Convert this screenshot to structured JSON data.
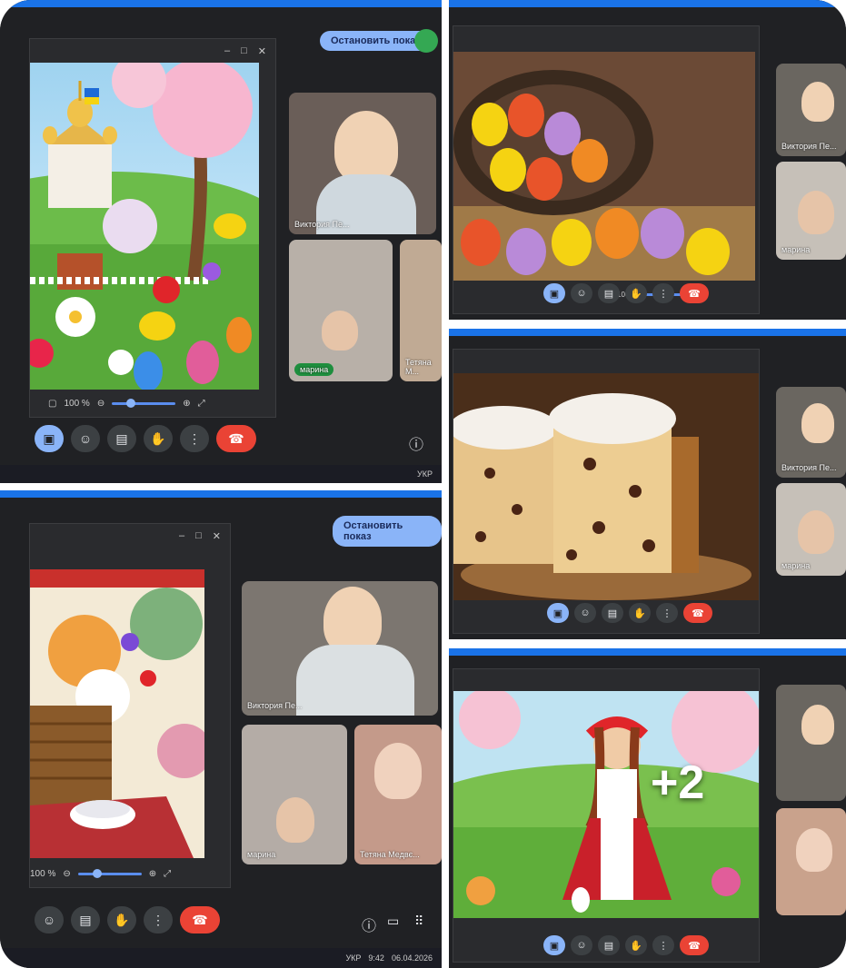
{
  "meeting": {
    "stop_share_label": "Остановить показ",
    "zoom_level": "100 %",
    "participants": {
      "p1": "Виктория Пе...",
      "p2": "марина",
      "p3": "Тетяна М...",
      "p3_full": "Тетяна Медвє..."
    }
  },
  "taskbar": {
    "lang": "УКР",
    "time": "9:42",
    "date": "06.04.2026"
  },
  "overlay": {
    "more_count": "+2"
  },
  "colors": {
    "accent": "#8ab4f8",
    "end_call": "#ea4335",
    "topbar": "#1a73e8",
    "dark": "#202124"
  },
  "icons": {
    "end_call": "phone-hangup-icon",
    "raise_hand": "hand-icon",
    "present": "present-screen-icon",
    "emoji": "emoji-icon",
    "captions": "captions-icon",
    "more": "more-vert-icon",
    "info": "info-icon"
  }
}
